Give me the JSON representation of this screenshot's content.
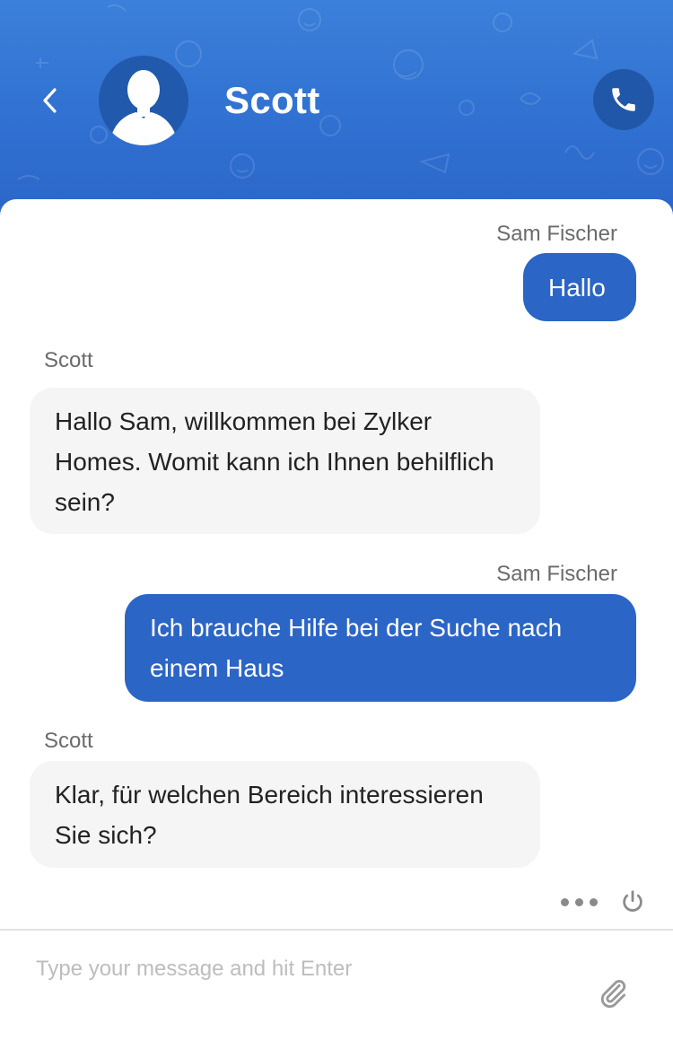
{
  "header": {
    "contact_name": "Scott",
    "background_color": "#2f6fd0",
    "icons": {
      "back": "chevron-left-icon",
      "avatar": "person-silhouette-icon",
      "call": "phone-icon"
    }
  },
  "messages": [
    {
      "direction": "outgoing",
      "sender": "Sam Fischer",
      "text": "Hallo"
    },
    {
      "direction": "incoming",
      "sender": "Scott",
      "text": "Hallo Sam, willkommen bei Zylker Homes. Womit kann ich Ihnen behilflich sein?"
    },
    {
      "direction": "outgoing",
      "sender": "Sam Fischer",
      "text": "Ich brauche Hilfe bei der Suche nach einem Haus"
    },
    {
      "direction": "incoming",
      "sender": "Scott",
      "text": "Klar, für welchen Bereich interessieren Sie sich?"
    }
  ],
  "colors": {
    "outgoing_bubble": "#2b65c6",
    "incoming_bubble": "#f5f5f5"
  },
  "toolbar": {
    "icons": {
      "more": "more-dots-icon",
      "end_chat": "power-icon"
    }
  },
  "composer": {
    "placeholder": "Type your message and hit Enter",
    "value": "",
    "attach_icon": "paperclip-icon"
  }
}
